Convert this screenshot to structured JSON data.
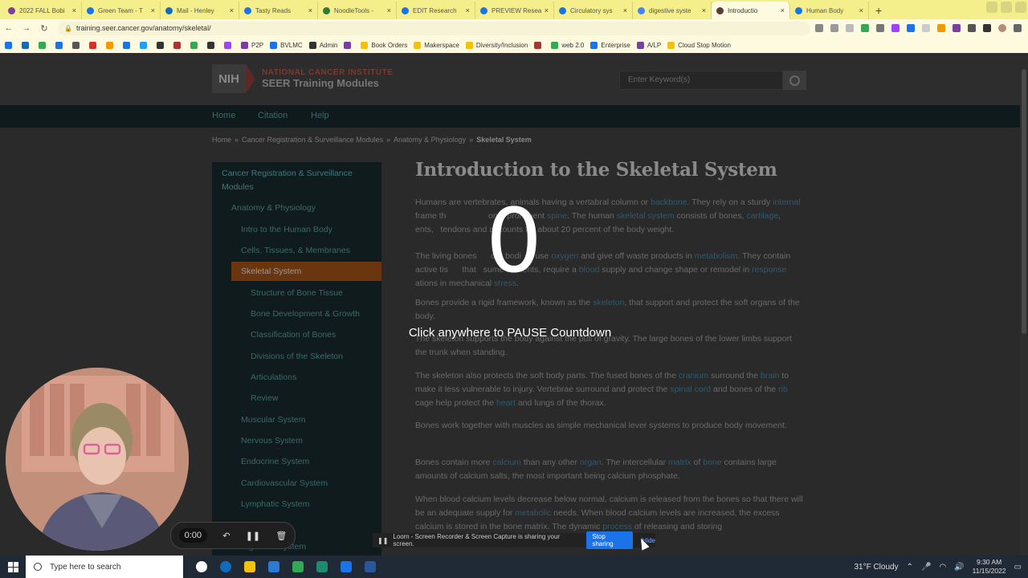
{
  "browser": {
    "tabs": [
      {
        "title": "2022 FALL Bobi",
        "color": "#7b3fa0"
      },
      {
        "title": "Green Team - T",
        "color": "#1a73e8"
      },
      {
        "title": "Mail - Henley",
        "color": "#0f6cbd"
      },
      {
        "title": "Tasty Reads",
        "color": "#1a73e8"
      },
      {
        "title": "NoodleTools -",
        "color": "#2b7a3a"
      },
      {
        "title": "EDIT Research",
        "color": "#1a73e8"
      },
      {
        "title": "PREVIEW Resea",
        "color": "#1a73e8"
      },
      {
        "title": "Circulatory sys",
        "color": "#1a73e8"
      },
      {
        "title": "digestive syste",
        "color": "#4285f4"
      },
      {
        "title": "Introductio",
        "color": "#5a3a3a",
        "active": true
      },
      {
        "title": "Human Body",
        "color": "#1a73e8"
      }
    ],
    "new_tab": "+",
    "url": "training.seer.cancer.gov/anatomy/skeletal/",
    "bookmarks": [
      {
        "label": "",
        "color": "#1a73e8"
      },
      {
        "label": "",
        "color": "#0f6cbd"
      },
      {
        "label": "",
        "color": "#34a853"
      },
      {
        "label": "",
        "color": "#1a73e8"
      },
      {
        "label": "",
        "color": "#555"
      },
      {
        "label": "",
        "color": "#d93025"
      },
      {
        "label": "",
        "color": "#f29900"
      },
      {
        "label": "",
        "color": "#1a73e8"
      },
      {
        "label": "",
        "color": "#1da1f2"
      },
      {
        "label": "",
        "color": "#333"
      },
      {
        "label": "",
        "color": "#a33"
      },
      {
        "label": "",
        "color": "#34a853"
      },
      {
        "label": "",
        "color": "#333"
      },
      {
        "label": "",
        "color": "#a142f4"
      },
      {
        "label": "P2P",
        "color": "#7b3fa0"
      },
      {
        "label": "BVLMC",
        "color": "#1a73e8"
      },
      {
        "label": "Admin",
        "color": "#333"
      },
      {
        "label": "",
        "color": "#7b3fa0"
      },
      {
        "label": "Book Orders",
        "color": "#f4c20d"
      },
      {
        "label": "Makerspace",
        "color": "#f4c20d"
      },
      {
        "label": "Diversity/Inclusion",
        "color": "#f4c20d"
      },
      {
        "label": "",
        "color": "#a33"
      },
      {
        "label": "web 2.0",
        "color": "#34a853"
      },
      {
        "label": "Enterprise",
        "color": "#1a73e8"
      },
      {
        "label": "A/LP",
        "color": "#7b3fa0"
      },
      {
        "label": "Cloud Stop Motion",
        "color": "#f4c20d"
      }
    ]
  },
  "site": {
    "logo_abbr": "NIH",
    "logo_line1": "NATIONAL CANCER INSTITUTE",
    "logo_line2": "SEER Training Modules",
    "search_placeholder": "Enter Keyword(s)",
    "nav": [
      "Home",
      "Citation",
      "Help"
    ],
    "breadcrumb": [
      "Home",
      "Cancer Registration & Surveillance Modules",
      "Anatomy & Physiology"
    ],
    "breadcrumb_current": "Skeletal System",
    "breadcrumb_sep": "»",
    "sidebar": [
      {
        "label": "Cancer Registration & Surveillance",
        "level": 0
      },
      {
        "label": "Modules",
        "level": 0
      },
      {
        "label": "Anatomy & Physiology",
        "level": 1
      },
      {
        "label": "Intro to the Human Body",
        "level": 2
      },
      {
        "label": "Cells, Tissues, & Membranes",
        "level": 2
      },
      {
        "label": "Skeletal System",
        "level": 2,
        "active": true
      },
      {
        "label": "Structure of Bone Tissue",
        "level": 3
      },
      {
        "label": "Bone Development & Growth",
        "level": 3
      },
      {
        "label": "Classification of Bones",
        "level": 3
      },
      {
        "label": "Divisions of the Skeleton",
        "level": 3
      },
      {
        "label": "Articulations",
        "level": 3
      },
      {
        "label": "Review",
        "level": 3
      },
      {
        "label": "Muscular System",
        "level": 2
      },
      {
        "label": "Nervous System",
        "level": 2
      },
      {
        "label": "Endocrine System",
        "level": 2
      },
      {
        "label": "Cardiovascular System",
        "level": 2
      },
      {
        "label": "Lymphatic System",
        "level": 2
      },
      {
        "label": "ry System",
        "level": 2
      },
      {
        "label": "Digestive System",
        "level": 2
      }
    ],
    "heading": "Introduction to the Skeletal System",
    "paragraphs": [
      [
        "Humans are vertebrates, animals having a vertabral column or ",
        {
          "link": "backbone"
        },
        ". They rely on a sturdy ",
        {
          "link": "internal"
        },
        " frame th",
        "                  ",
        "on a prominent ",
        {
          "link": "spine"
        },
        ". The human ",
        {
          "link": "skeletal system"
        },
        " consists of bones, ",
        {
          "link": "cartilage"
        },
        ", ",
        "        ",
        "ents, ",
        "  tendons and accounts for about 20 percent of the body weight."
      ],
      [
        "The living bones ",
        "     ",
        "our bodi",
        "      ",
        "use ",
        {
          "link": "oxygen"
        },
        " and give off waste products in ",
        {
          "link": "metabolism"
        },
        ". They contain active tis",
        "      ",
        "that",
        "   ",
        "sume nutrients, require a ",
        {
          "link": "blood"
        },
        " supply and change shape or remodel in ",
        {
          "link": "response"
        },
        " ",
        "        ",
        "ations in mechanical ",
        {
          "link": "stress"
        },
        "."
      ],
      [
        "Bones provide a rigid framework, known as the ",
        {
          "link": "skeleton"
        },
        ", that support and protect the soft organs of the body."
      ],
      [
        "The skeleton supports the body against the pull of gravity. The large bones of the lower limbs support the trunk when standing."
      ],
      [
        "The skeleton also protects the soft body parts. The fused bones of the ",
        {
          "link": "cranium"
        },
        " surround the ",
        {
          "link": "brain"
        },
        " to make it less vulnerable to injury. Vertebrae surround and protect the ",
        {
          "link": "spinal cord"
        },
        " and bones of the ",
        {
          "link": "rib"
        },
        " cage help protect the ",
        {
          "link": "heart"
        },
        " and lungs of the thorax."
      ],
      [
        "Bones work together with muscles as simple mechanical lever systems to produce body movement."
      ],
      [
        "Bones contain more ",
        {
          "link": "calcium"
        },
        " than any other ",
        {
          "link": "organ"
        },
        ". The intercellular ",
        {
          "link": "matrix"
        },
        " of ",
        {
          "link": "bone"
        },
        " contains large amounts of calcium salts, the most important being calcium phosphate."
      ],
      [
        "When blood calcium levels decrease below normal, calcium is released from the bones so that there will be an adequate supply for ",
        {
          "link": "metabolic"
        },
        " needs. When blood calcium levels are increased, the excess calcium is stored in the bone matrix. The dynamic ",
        {
          "link": "process"
        },
        " of releasing and storing"
      ]
    ]
  },
  "loom": {
    "countdown": "0",
    "pause_message": "Click anywhere to PAUSE Countdown",
    "timer": "0:00",
    "share_message": "Loom - Screen Recorder & Screen Capture is sharing your screen.",
    "stop_label": "Stop sharing",
    "hide_label": "Hide"
  },
  "taskbar": {
    "search_placeholder": "Type here to search",
    "weather": "31°F  Cloudy",
    "time": "9:30 AM",
    "date": "11/15/2022",
    "apps": [
      "#ffffff",
      "#0f6cbd",
      "#f4c20d",
      "#2b7bd6",
      "#34a853",
      "#1f8a70",
      "#1a73e8",
      "#2b579a"
    ]
  }
}
